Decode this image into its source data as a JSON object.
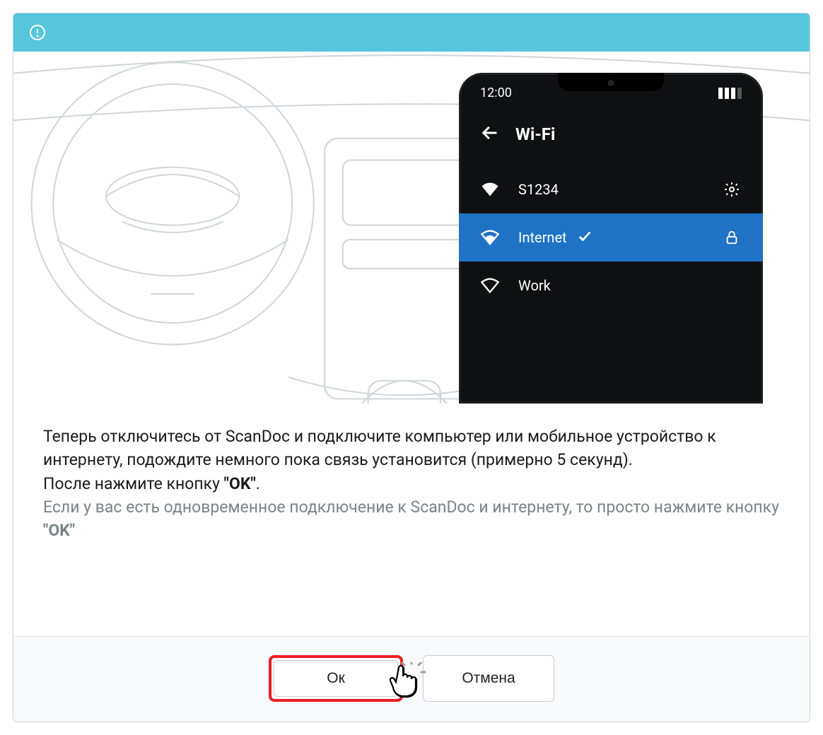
{
  "phone": {
    "time": "12:00",
    "screen_title": "Wi-Fi",
    "networks": [
      {
        "name": "S1234",
        "signal": "full",
        "action": "settings",
        "selected": false
      },
      {
        "name": "Internet",
        "signal": "full",
        "action": "locked",
        "selected": true
      },
      {
        "name": "Work",
        "signal": "outline",
        "action": "",
        "selected": false
      }
    ]
  },
  "message": {
    "line1": "Теперь отключитесь от ScanDoc и подключите компьютер или мобильное устройство к интернету, подождите немного пока связь установится (примерно 5 секунд).",
    "line2_prefix": "После нажмите кнопку ",
    "line2_bold": "\"OK\"",
    "line2_suffix": ".",
    "hint_prefix": "Если у вас есть одновременное подключение к ScanDoc и интернету, то просто нажмите кнопку ",
    "hint_bold": "\"OK\""
  },
  "buttons": {
    "ok": "Ок",
    "cancel": "Отмена"
  }
}
